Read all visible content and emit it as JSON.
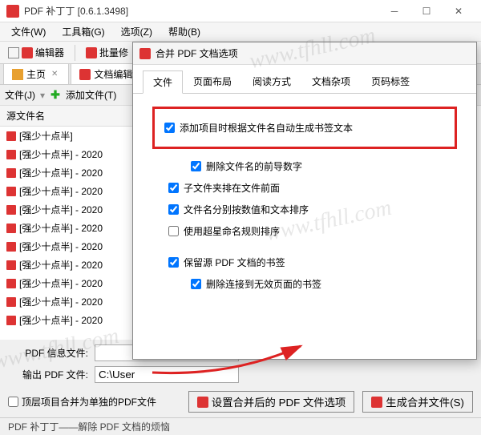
{
  "app": {
    "title": "PDF 补丁丁 [0.6.1.3498]"
  },
  "menus": {
    "file": "文件(W)",
    "tools": "工具箱(G)",
    "options": "选项(Z)",
    "help": "帮助(B)"
  },
  "toolbar": {
    "editor": "编辑器",
    "batch": "批量修"
  },
  "tabs": {
    "home": "主页",
    "docedit": "文档编辑"
  },
  "subbar": {
    "files": "文件(J)",
    "addfiles": "添加文件(T)"
  },
  "panel": {
    "header": "源文件名",
    "files": [
      "[强少十点半]",
      "[强少十点半] - 2020",
      "[强少十点半] - 2020",
      "[强少十点半] - 2020",
      "[强少十点半] - 2020",
      "[强少十点半] - 2020",
      "[强少十点半] - 2020",
      "[强少十点半] - 2020",
      "[强少十点半] - 2020",
      "[强少十点半] - 2020",
      "[强少十点半] - 2020"
    ]
  },
  "dialog": {
    "title": "合并 PDF 文档选项",
    "tabs": {
      "file": "文件",
      "layout": "页面布局",
      "reading": "阅读方式",
      "misc": "文档杂项",
      "pagelabel": "页码标签"
    },
    "cb_auto_bookmark": "添加项目时根据文件名自动生成书签文本",
    "cb_trim_number": "删除文件名的前导数字",
    "cb_folder_front": "子文件夹排在文件前面",
    "cb_sort": "文件名分别按数值和文本排序",
    "cb_cx": "使用超星命名规则排序",
    "cb_keep_bm": "保留源 PDF 文档的书签",
    "cb_del_invalid": "删除连接到无效页面的书签"
  },
  "bottom": {
    "pdfinfo_label": "PDF 信息文件:",
    "output_label": "输出 PDF 文件:",
    "output_value": "C:\\User",
    "cb_toplevel": "顶层项目合并为单独的PDF文件",
    "btn_options": "设置合并后的 PDF 文件选项",
    "btn_generate": "生成合并文件(S)"
  },
  "status": "PDF 补丁丁——解除 PDF 文档的烦恼",
  "watermark": "www.tfhll.com"
}
